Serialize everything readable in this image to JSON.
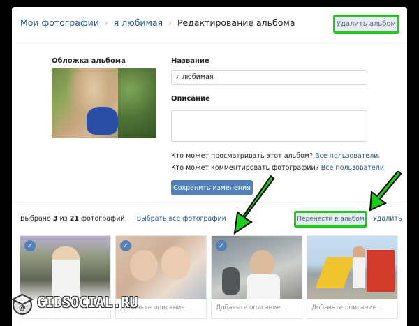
{
  "breadcrumb": {
    "items": [
      "Мои фотографии",
      "я любимая"
    ],
    "current": "Редактирование альбома"
  },
  "header": {
    "delete_album_label": "Удалить альбом"
  },
  "album": {
    "cover_label": "Обложка альбома",
    "name_label": "Название",
    "name_value": "я любимая",
    "description_label": "Описание",
    "description_value": ""
  },
  "permissions": {
    "view_text": "Кто может просматривать этот альбом?",
    "view_value": "Все пользователи.",
    "comment_text": "Кто может комментировать фотографии?",
    "comment_value": "Все пользователи."
  },
  "save_label": "Сохранить изменения",
  "selection": {
    "prefix": "Выбрано",
    "selected": "3",
    "of": "из",
    "total": "21",
    "suffix": "фотографий",
    "select_all": "Выбрать все фотографии",
    "move_label": "Перенести в альбом",
    "delete_label": "Удалить"
  },
  "photos": [
    {
      "caption": "",
      "selected": true
    },
    {
      "caption": "Добавьте описание...",
      "selected": true
    },
    {
      "caption": "Добавьте описание...",
      "selected": true
    },
    {
      "caption": "Добавьте описание...",
      "selected": false
    }
  ],
  "watermark": {
    "text": "GIDSOCIAL.RU"
  },
  "colors": {
    "highlight": "#1dcc1a",
    "link": "#2a5885",
    "primary": "#5181b8"
  }
}
